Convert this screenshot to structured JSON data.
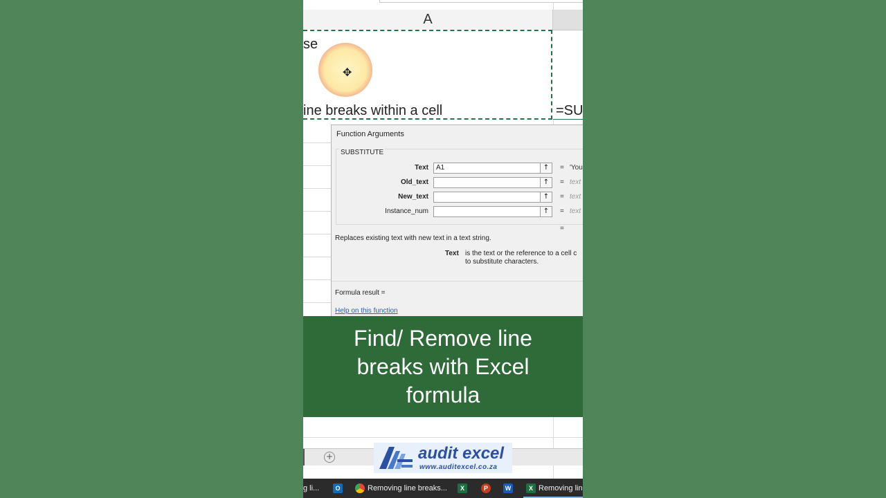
{
  "spreadsheet": {
    "column_a_header": "A",
    "cell_a1_line1": "se",
    "cell_a1_line3": "ine breaks within a cell",
    "cell_b1_formula": "=SU"
  },
  "dialog": {
    "title": "Function Arguments",
    "function_name": "SUBSTITUTE",
    "args": [
      {
        "label": "Text",
        "value": "A1",
        "bold": true,
        "result": "'You",
        "result_is_value": true
      },
      {
        "label": "Old_text",
        "value": "",
        "bold": true,
        "result": "text",
        "result_is_value": false
      },
      {
        "label": "New_text",
        "value": "",
        "bold": true,
        "result": "text",
        "result_is_value": false
      },
      {
        "label": "Instance_num",
        "value": "",
        "bold": false,
        "result": "text",
        "result_is_value": false
      }
    ],
    "equals": "=",
    "description": "Replaces existing text with new text in a text string.",
    "arg_help_name": "Text",
    "arg_help_line1": "is the text or the reference to a cell c",
    "arg_help_line2": "to substitute characters.",
    "formula_result_label": "Formula result =",
    "help_link": "Help on this function"
  },
  "banner": {
    "lines": [
      "Find/ Remove line",
      "breaks with Excel",
      "formula"
    ],
    "background": "#2e6b39"
  },
  "sheet_tabs": {
    "add_sheet_symbol": "⊕"
  },
  "logo": {
    "name": "audit excel",
    "url": "www.auditexcel.co.za"
  },
  "taskbar": {
    "items": [
      {
        "label": "g li...",
        "icon": ""
      },
      {
        "label": "",
        "icon": "outlook-icon"
      },
      {
        "label": "Removing line breaks...",
        "icon": "chrome-icon"
      },
      {
        "label": "",
        "icon": "excel-icon"
      },
      {
        "label": "",
        "icon": "powerpoint-icon"
      },
      {
        "label": "",
        "icon": "word-icon"
      },
      {
        "label": "Removing lin",
        "icon": "excel-icon"
      }
    ]
  },
  "colors": {
    "page_background": "#4f8559",
    "excel_green": "#217346",
    "link_blue": "#2a5db0"
  }
}
